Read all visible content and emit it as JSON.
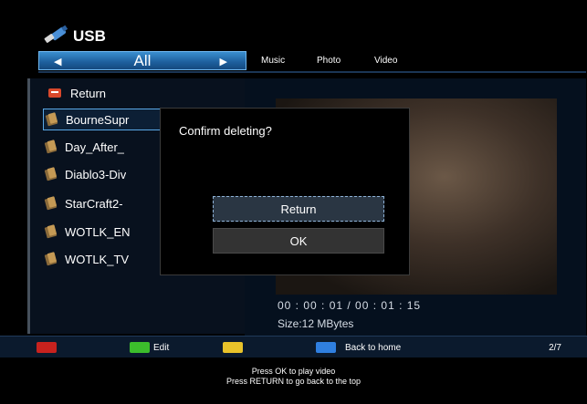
{
  "header": {
    "source_label": "USB"
  },
  "categories": {
    "selected": "All",
    "tabs": [
      "Music",
      "Photo",
      "Video"
    ]
  },
  "file_list": {
    "return_label": "Return",
    "items": [
      "BourneSupr",
      "Day_After_",
      "Diablo3-Div",
      "StarCraft2-",
      "WOTLK_EN",
      "WOTLK_TV"
    ]
  },
  "preview": {
    "time": "00 : 00 : 01  / 00 : 01 : 15",
    "size": "Size:12 MBytes"
  },
  "dialog": {
    "title": "Confirm deleting?",
    "buttons": [
      "Return",
      "OK"
    ],
    "selected_index": 0
  },
  "bottom_bar": {
    "green_label": "Edit",
    "blue_label": "Back to home",
    "page": "2/7",
    "colors": {
      "red": "#c8221e",
      "green": "#3cbd2c",
      "yellow": "#e8c22a",
      "blue": "#2f7fe0"
    }
  },
  "hints": {
    "line1": "Press OK to play video",
    "line2": "Press RETURN to go back to the top"
  }
}
